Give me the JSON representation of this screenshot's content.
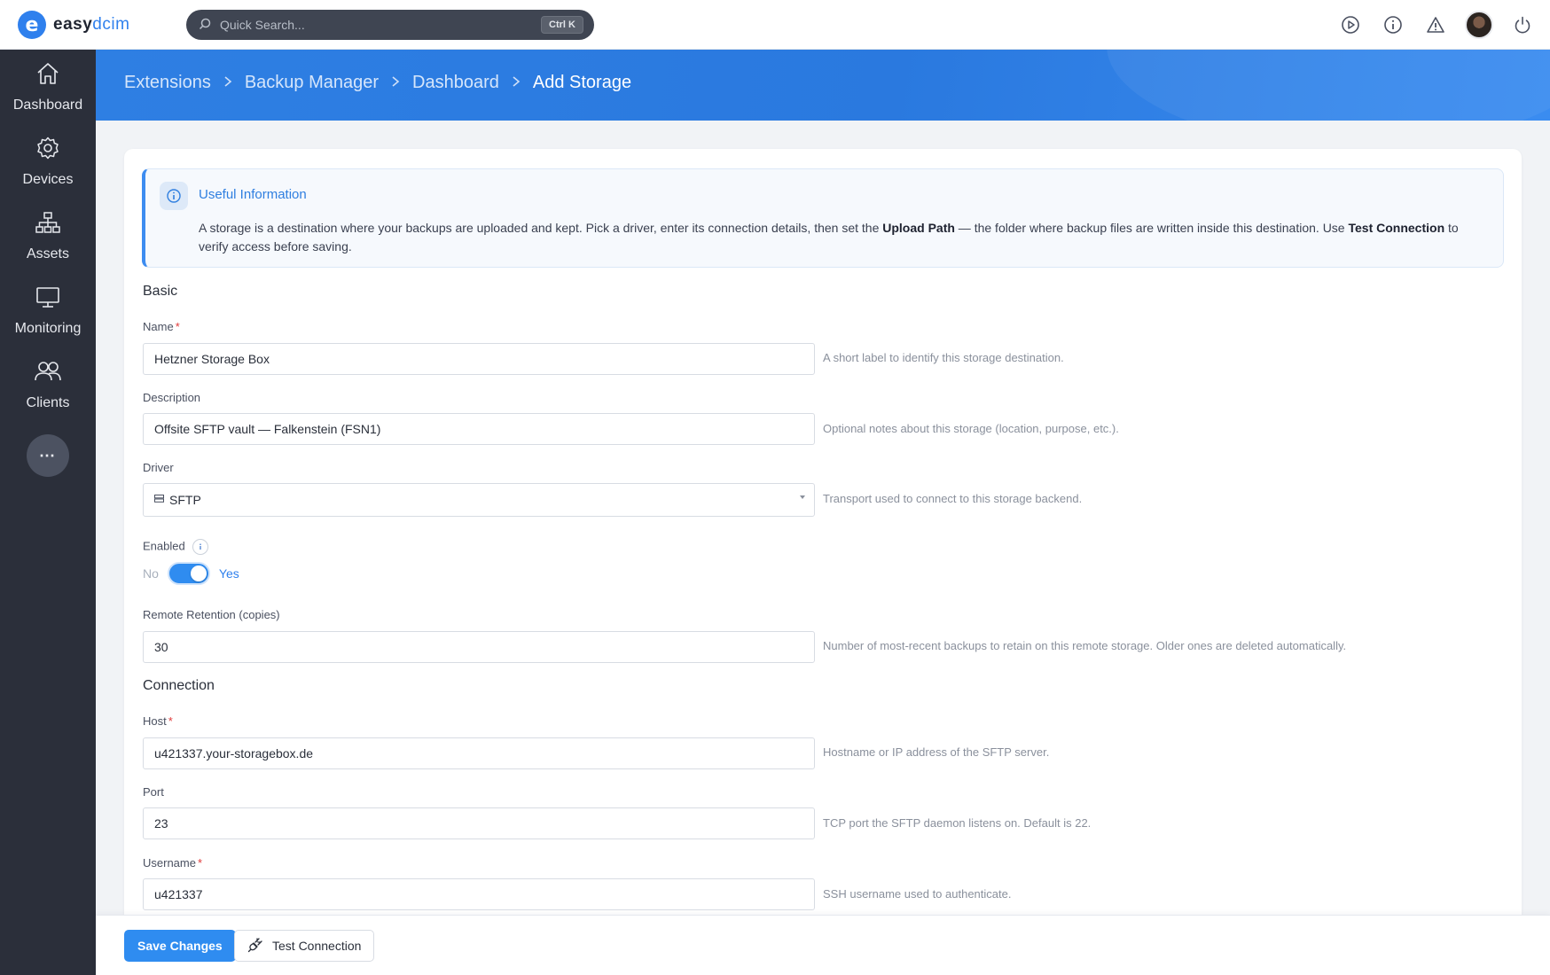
{
  "app": {
    "logo_letter": "e",
    "logo_text": "easy",
    "logo_accent": "dcim"
  },
  "search": {
    "placeholder": "Quick Search...",
    "shortcut": "Ctrl K"
  },
  "top_icons": [
    "play-circle-icon",
    "info-icon",
    "warning-icon",
    "avatar",
    "power-icon"
  ],
  "sidebar": {
    "items": [
      {
        "label": "Dashboard",
        "icon": "home-icon"
      },
      {
        "label": "Devices",
        "icon": "gear-icon"
      },
      {
        "label": "Assets",
        "icon": "hierarchy-icon"
      },
      {
        "label": "Monitoring",
        "icon": "monitor-icon"
      },
      {
        "label": "Clients",
        "icon": "users-icon"
      }
    ],
    "more": "⋯"
  },
  "breadcrumb": [
    "Extensions",
    "Backup Manager",
    "Dashboard",
    "Add Storage"
  ],
  "info": {
    "title": "Useful Information",
    "text_1": "A storage is a destination where your backups are uploaded and kept. Pick a driver, enter its connection details, then set the ",
    "bold_1": "Upload Path",
    "text_2": " — the folder where backup files are written inside this destination. Use ",
    "bold_2": "Test Connection",
    "text_3": " to verify access before saving."
  },
  "form": {
    "section_basic": "Basic",
    "name": {
      "label": "Name",
      "value": "Hetzner Storage Box",
      "help": "A short label to identify this storage destination."
    },
    "description": {
      "label": "Description",
      "value": "Offsite SFTP vault — Falkenstein (FSN1)",
      "help": "Optional notes about this storage (location, purpose, etc.)."
    },
    "driver": {
      "label": "Driver",
      "value": "SFTP",
      "help": "Transport used to connect to this storage backend."
    },
    "enabled": {
      "label": "Enabled",
      "off_label": "No",
      "on_label": "Yes",
      "value": true
    },
    "retention": {
      "label": "Remote Retention (copies)",
      "value": "30",
      "help": "Number of most-recent backups to retain on this remote storage. Older ones are deleted automatically."
    },
    "section_connection": "Connection",
    "host": {
      "label": "Host",
      "value": "u421337.your-storagebox.de",
      "help": "Hostname or IP address of the SFTP server."
    },
    "port": {
      "label": "Port",
      "value": "23",
      "help": "TCP port the SFTP daemon listens on. Default is 22."
    },
    "username": {
      "label": "Username",
      "value": "u421337",
      "help": "SSH username used to authenticate."
    },
    "required_mark": "*"
  },
  "footer": {
    "save_label": "Save Changes",
    "test_label": "Test Connection"
  },
  "colors": {
    "accent": "#2f80ed",
    "sidebar": "#2b2f3a",
    "required": "#e03a3a"
  }
}
